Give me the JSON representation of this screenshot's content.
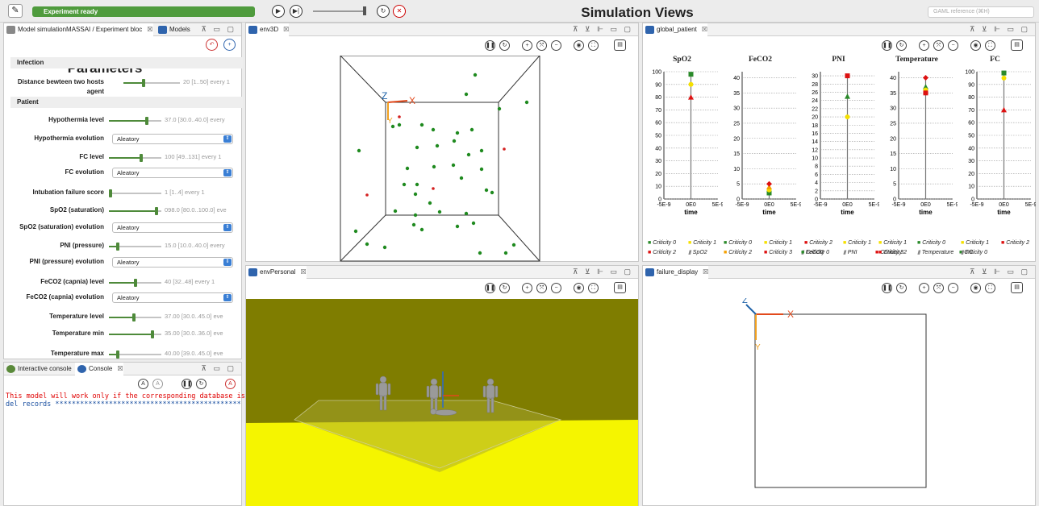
{
  "toolbar": {
    "status": "Experiment ready",
    "title": "Simulation Views",
    "search_placeholder": "GAML reference (⌘H)"
  },
  "params_pane": {
    "tab": "Model simulationMASSAI / Experiment bloc",
    "tab2": "Models",
    "title": "Parameters",
    "sections": [
      "Infection",
      "Patient"
    ],
    "items": [
      {
        "label": "Distance bewteen two hosts agent",
        "value": "20 [1..50] every 1",
        "level": 0.35
      },
      {
        "label": "Hypothermia level",
        "value": "37.0 [30.0..40.0] every",
        "level": 0.72
      },
      {
        "label": "Hypothermia evolution",
        "select": "Aleatory"
      },
      {
        "label": "FC level",
        "value": "100 [49..131] every 1",
        "level": 0.62
      },
      {
        "label": "FC evolution",
        "select": "Aleatory"
      },
      {
        "label": "Intubation failure score",
        "value": "1 [1..4] every 1",
        "level": 0.0
      },
      {
        "label": "SpO2 (saturation)",
        "value": "098.0 [80.0..100.0] eve",
        "level": 0.9
      },
      {
        "label": "SpO2 (saturation) evolution",
        "select": "Aleatory"
      },
      {
        "label": "PNI (pressure)",
        "value": "15.0 [10.0..40.0] every",
        "level": 0.17
      },
      {
        "label": "PNI (pressure) evolution",
        "select": "Aleatory"
      },
      {
        "label": "FeCO2 (capnia) level",
        "value": "40 [32..48] every 1",
        "level": 0.5
      },
      {
        "label": "FeCO2 (capnia) evolution",
        "select": "Aleatory"
      },
      {
        "label": "Temperature level",
        "value": "37.00 [30.0..45.0] eve",
        "level": 0.47
      },
      {
        "label": "Temperature min",
        "value": "35.00 [30.0..36.0] eve",
        "level": 0.83
      },
      {
        "label": "Temperature max",
        "value": "40.00 [39.0..45.0] eve",
        "level": 0.17
      }
    ]
  },
  "console": {
    "tab1": "Interactive console",
    "tab2": "Console",
    "line1": "This model will work only if the corresponding database is i",
    "line2": "del records *********************************************"
  },
  "env3d": {
    "tab": "env3D"
  },
  "envpersonal": {
    "tab": "envPersonal"
  },
  "failure": {
    "tab": "failure_display"
  },
  "global": {
    "tab": "global_patient"
  },
  "axes": {
    "x": "X",
    "y": "Y",
    "z": "Z"
  },
  "chart_data": [
    {
      "type": "scatter",
      "title": "SpO2",
      "xlabel": "time",
      "xticks": [
        "-5E-9",
        "0E0",
        "5E-9"
      ],
      "yticks": [
        "0",
        "10",
        "20",
        "30",
        "40",
        "50",
        "60",
        "70",
        "80",
        "90",
        "100"
      ],
      "ylim": [
        0,
        100
      ],
      "points": [
        {
          "y": 98,
          "color": "#2a8a2a",
          "shape": "square"
        },
        {
          "y": 90,
          "color": "#f5e000",
          "shape": "circle"
        },
        {
          "y": 80,
          "color": "#dd1111",
          "shape": "triangle"
        }
      ],
      "legend": [
        {
          "label": "Criticity 0",
          "color": "#2a8a2a"
        },
        {
          "label": "Criticity 1",
          "color": "#f5e000"
        },
        {
          "label": "Criticity 2",
          "color": "#dd1111"
        },
        {
          "label": "SpO2",
          "color": "#888888"
        }
      ]
    },
    {
      "type": "scatter",
      "title": "FeCO2",
      "xlabel": "time",
      "xticks": [
        "-5E-9",
        "0E0",
        "5E-9"
      ],
      "yticks": [
        "0",
        "5",
        "10",
        "15",
        "20",
        "25",
        "30",
        "35",
        "40"
      ],
      "ylim": [
        0,
        42
      ],
      "points": [
        {
          "y": 2,
          "color": "#2a8a2a",
          "shape": "square"
        },
        {
          "y": 3,
          "color": "#f5e000",
          "shape": "circle"
        },
        {
          "y": 4,
          "color": "#f5a000",
          "shape": "triangle"
        },
        {
          "y": 5,
          "color": "#dd1111",
          "shape": "diamond"
        }
      ],
      "legend": [
        {
          "label": "Criticity 0",
          "color": "#2a8a2a"
        },
        {
          "label": "Criticity 1",
          "color": "#f5e000"
        },
        {
          "label": "Criticity 2",
          "color": "#f5a000"
        },
        {
          "label": "Criticity 3",
          "color": "#dd1111"
        },
        {
          "label": "FeCO2",
          "color": "#888888"
        }
      ]
    },
    {
      "type": "scatter",
      "title": "PNI",
      "xlabel": "time",
      "xticks": [
        "-5E-9",
        "0E0",
        "5E-9"
      ],
      "yticks": [
        "0",
        "2",
        "4",
        "6",
        "8",
        "10",
        "12",
        "14",
        "16",
        "18",
        "20",
        "22",
        "24",
        "26",
        "28",
        "30"
      ],
      "ylim": [
        0,
        31
      ],
      "points": [
        {
          "y": 30,
          "color": "#dd1111",
          "shape": "square"
        },
        {
          "y": 25,
          "color": "#2a8a2a",
          "shape": "triangle"
        },
        {
          "y": 20,
          "color": "#f5e000",
          "shape": "circle"
        }
      ],
      "legend": [
        {
          "label": "Criticity 2",
          "color": "#dd1111"
        },
        {
          "label": "Criticity 1",
          "color": "#f5e000"
        },
        {
          "label": "Criticity 0",
          "color": "#2a8a2a"
        },
        {
          "label": "PNI",
          "color": "#888888"
        }
      ]
    },
    {
      "type": "scatter",
      "title": "Temperature",
      "xlabel": "time",
      "xticks": [
        "-5E-9",
        "0E0",
        "5E-9"
      ],
      "yticks": [
        "0",
        "5",
        "10",
        "15",
        "20",
        "25",
        "30",
        "35",
        "40"
      ],
      "ylim": [
        0,
        42
      ],
      "points": [
        {
          "y": 40,
          "color": "#dd1111",
          "shape": "diamond"
        },
        {
          "y": 37,
          "color": "#2a8a2a",
          "shape": "triangle"
        },
        {
          "y": 36,
          "color": "#f5e000",
          "shape": "circle"
        },
        {
          "y": 35,
          "color": "#dd1111",
          "shape": "square"
        }
      ],
      "legend": [
        {
          "label": "Criticity 3",
          "color": "#dd1111"
        },
        {
          "label": "Criticity 1",
          "color": "#f5e000"
        },
        {
          "label": "Criticity 0",
          "color": "#2a8a2a"
        },
        {
          "label": "Criticity 2",
          "color": "#dd1111"
        },
        {
          "label": "Temperature",
          "color": "#888888"
        }
      ]
    },
    {
      "type": "scatter",
      "title": "FC",
      "xlabel": "time",
      "xticks": [
        "-5E-9",
        "0E0",
        "5E-9"
      ],
      "yticks": [
        "0",
        "10",
        "20",
        "30",
        "40",
        "50",
        "60",
        "70",
        "80",
        "90",
        "100"
      ],
      "ylim": [
        0,
        100
      ],
      "points": [
        {
          "y": 99,
          "color": "#2a8a2a",
          "shape": "square"
        },
        {
          "y": 95,
          "color": "#f5e000",
          "shape": "circle"
        },
        {
          "y": 70,
          "color": "#dd1111",
          "shape": "triangle"
        }
      ],
      "legend": [
        {
          "label": "Criticity 0",
          "color": "#2a8a2a"
        },
        {
          "label": "Criticity 1",
          "color": "#f5e000"
        },
        {
          "label": "Criticity 2",
          "color": "#dd1111"
        },
        {
          "label": "FC",
          "color": "#888888"
        }
      ]
    }
  ]
}
